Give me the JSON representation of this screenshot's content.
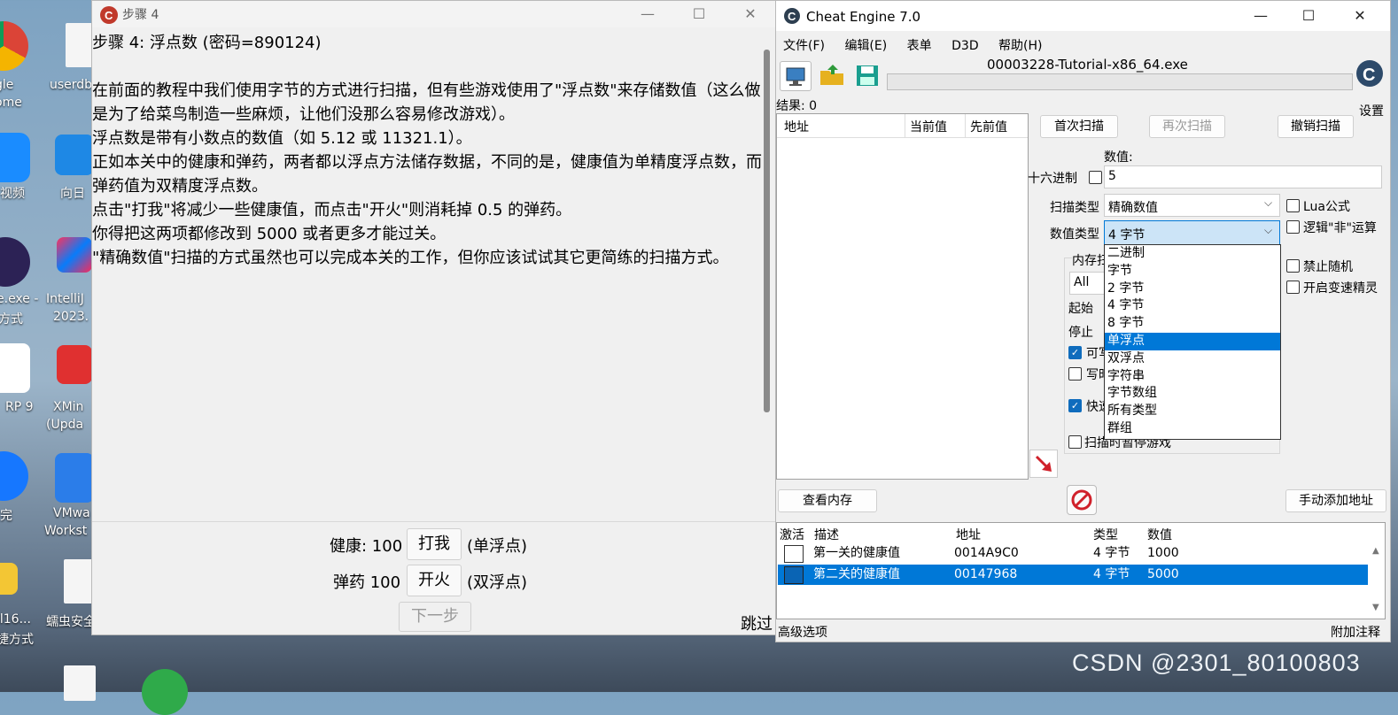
{
  "desktop": {
    "icons": [
      {
        "label1": "gle",
        "label2": "ome"
      },
      {
        "label1": "userdb",
        "label2": ""
      },
      {
        "label1": "视频",
        "label2": ""
      },
      {
        "label1": "向日",
        "label2": ""
      },
      {
        "label1": "e.exe -",
        "label2": "方式"
      },
      {
        "label1": "IntelliJ",
        "label2": "2023."
      },
      {
        "label1": "RP 9",
        "label2": ""
      },
      {
        "label1": "XMin",
        "label2": "(Upda"
      },
      {
        "label1": "完",
        "label2": ""
      },
      {
        "label1": "VMwa",
        "label2": "Workst"
      },
      {
        "label1": "ll16...",
        "label2": "捷方式"
      },
      {
        "label1": "蠕虫安全",
        "label2": ""
      }
    ],
    "watermark": "CSDN @2301_80100803"
  },
  "tutorial": {
    "title": "步骤 4",
    "heading": "步骤 4: 浮点数 (密码=890124)",
    "paragraphs": [
      "在前面的教程中我们使用字节的方式进行扫描，但有些游戏使用了\"浮点数\"来存储数值（这么做是为了给菜鸟制造一些麻烦，让他们没那么容易修改游戏）。",
      "浮点数是带有小数点的数值（如 5.12 或 11321.1）。",
      "正如本关中的健康和弹药，两者都以浮点方法储存数据，不同的是，健康值为单精度浮点数，而弹药值为双精度浮点数。",
      "点击\"打我\"将减少一些健康值，而点击\"开火\"则消耗掉 0.5 的弹药。",
      "你得把这两项都修改到 5000 或者更多才能过关。",
      "\"精确数值\"扫描的方式虽然也可以完成本关的工作，但你应该试试其它更简练的扫描方式。"
    ],
    "health_label": "健康: 100",
    "hit_button": "打我",
    "health_type": "(单浮点)",
    "ammo_label": "弹药 100",
    "fire_button": "开火",
    "ammo_type": "(双浮点)",
    "next_button": "下一步",
    "skip_label": "跳过"
  },
  "ce": {
    "title": "Cheat Engine 7.0",
    "menu": [
      "文件(F)",
      "编辑(E)",
      "表单",
      "D3D",
      "帮助(H)"
    ],
    "process": "00003228-Tutorial-x86_64.exe",
    "settings_label": "设置",
    "results": "结果: 0",
    "found_columns": [
      "地址",
      "当前值",
      "先前值"
    ],
    "first_scan": "首次扫描",
    "next_scan": "再次扫描",
    "undo_scan": "撤销扫描",
    "value_label": "数值:",
    "hex_label": "十六进制",
    "value": "5",
    "scan_type_label": "扫描类型",
    "scan_type": "精确数值",
    "value_type_label": "数值类型",
    "value_type": "4 字节",
    "lua_label": "Lua公式",
    "not_label": "逻辑\"非\"运算",
    "value_type_options": [
      "二进制",
      "字节",
      "2 字节",
      "4 字节",
      "8 字节",
      "单浮点",
      "双浮点",
      "字符串",
      "字节数组",
      "所有类型",
      "群组"
    ],
    "highlighted_option": "单浮点",
    "mem_label": "内存扫",
    "mem_value": "All",
    "start_label": "起始",
    "stop_label": "停止",
    "writable_label": "可写",
    "copy_on_write_label": "写时",
    "fast_scan_label": "快速",
    "pause_label": "扫描时暂停游戏",
    "no_random_label": "禁止随机",
    "speedhack_label": "开启变速精灵",
    "view_memory": "查看内存",
    "add_address": "手动添加地址",
    "table_columns": [
      "激活",
      "描述",
      "地址",
      "类型",
      "数值"
    ],
    "table_rows": [
      {
        "desc": "第一关的健康值",
        "addr": "0014A9C0",
        "type": "4 字节",
        "value": "1000"
      },
      {
        "desc": "第二关的健康值",
        "addr": "00147968",
        "type": "4 字节",
        "value": "5000"
      }
    ],
    "advanced_options": "高级选项",
    "comments": "附加注释"
  }
}
